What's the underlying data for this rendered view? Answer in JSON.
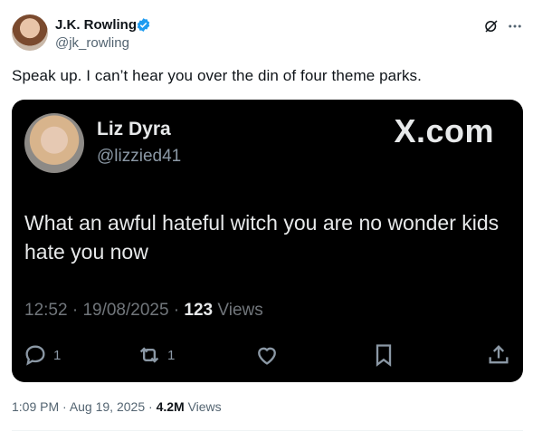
{
  "author": {
    "name": "J.K. Rowling",
    "handle": "@jk_rowling"
  },
  "tweet": {
    "text": "Speak up. I can’t hear you over the din of four theme parks.",
    "time": "1:09 PM",
    "date": "Aug 19, 2025",
    "views_count": "4.2M",
    "views_label": "Views"
  },
  "embedded": {
    "name": "Liz Dyra",
    "handle": "@lizzied41",
    "brand": "X.com",
    "text": "What an awful hateful witch you are no wonder kids hate you now",
    "time": "12:52",
    "date": "19/08/2025",
    "views_count": "123",
    "views_label": "Views",
    "replies": "1",
    "reposts": "1"
  },
  "icons": {
    "verified": "verified-badge-icon",
    "grok": "grok-icon",
    "more": "more-icon",
    "reply": "reply-icon",
    "repost": "repost-icon",
    "like": "heart-icon",
    "bookmark": "bookmark-icon",
    "share": "share-icon"
  },
  "colors": {
    "verified": "#1d9bf0",
    "muted": "#536471",
    "embed_bg": "#000000"
  }
}
